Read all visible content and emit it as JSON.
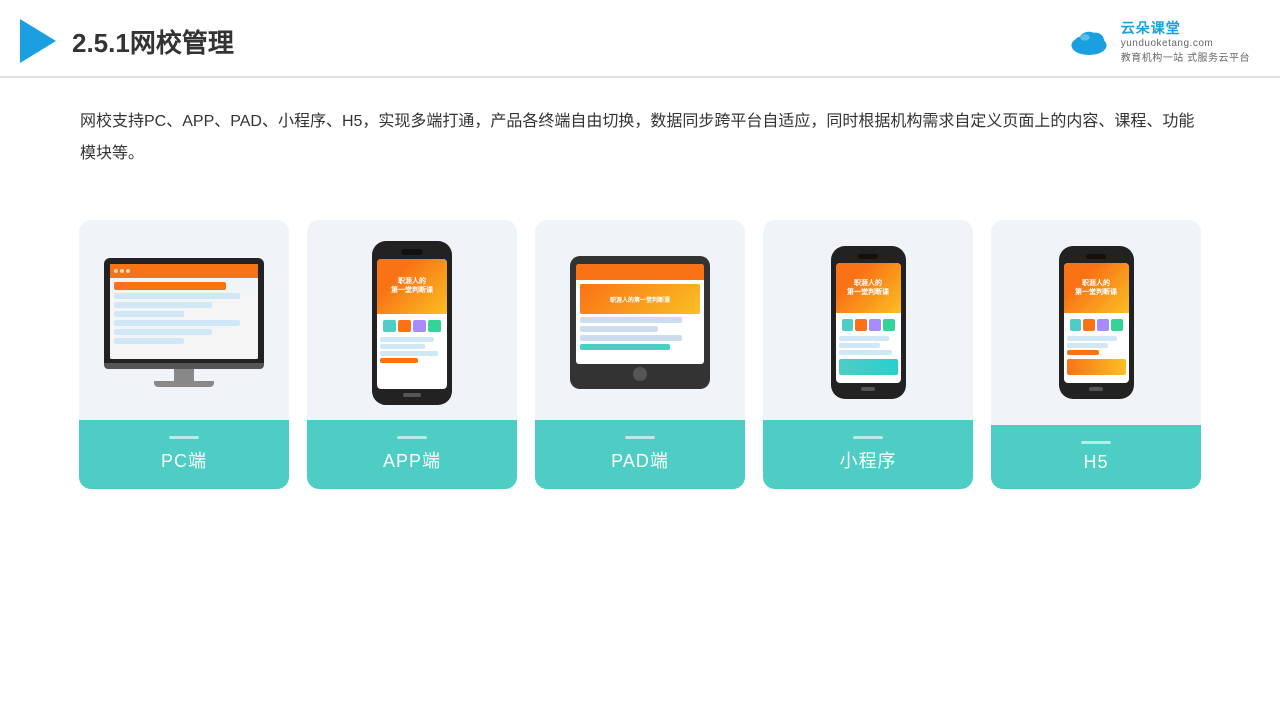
{
  "header": {
    "title": "2.5.1网校管理",
    "logo_name": "云朵课堂",
    "logo_sub_line1": "教育机构一站",
    "logo_sub_line2": "式服务云平台",
    "logo_domain": "yunduoketang.com"
  },
  "description": {
    "text": "网校支持PC、APP、PAD、小程序、H5，实现多端打通，产品各终端自由切换，数据同步跨平台自适应，同时根据机构需求自定义页面上的内容、课程、功能模块等。"
  },
  "cards": [
    {
      "id": "pc",
      "label": "PC端"
    },
    {
      "id": "app",
      "label": "APP端"
    },
    {
      "id": "pad",
      "label": "PAD端"
    },
    {
      "id": "miniprogram",
      "label": "小程序"
    },
    {
      "id": "h5",
      "label": "H5"
    }
  ],
  "accent_color": "#4ecdc4",
  "orange_color": "#f97316"
}
